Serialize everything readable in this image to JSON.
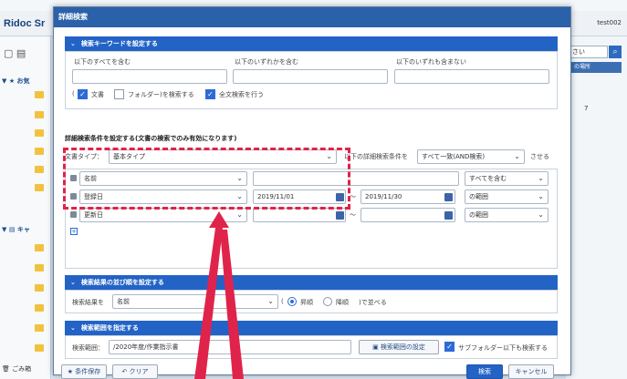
{
  "background": {
    "logo": "Ridoc Sr",
    "user": "test002",
    "favorites": "お気",
    "cabinet": "キャ",
    "trash": "ごみ箱",
    "search_placeholder": "さい",
    "place_label": "の場所",
    "side_number": "7"
  },
  "modal": {
    "title": "詳細検索",
    "keyword_section": {
      "header": "検索キーワードを設定する",
      "all_label": "以下のすべてを含む",
      "any_label": "以下のいずれかを含む",
      "none_label": "以下のいずれも含まない",
      "all_value": "",
      "any_value": "",
      "none_value": "",
      "paren_open": "(",
      "doc_label": "文書",
      "folder_label": "フォルダー)を検索する",
      "fulltext_label": "全文検索を行う"
    },
    "condition_section": {
      "title": "詳細検索条件を設定する(文書の検索でのみ有効になります)",
      "doctype_label": "文書タイプ：",
      "doctype_value": "基本タイプ",
      "cond_mode_label": "以下の詳細検索条件を",
      "cond_mode_value": "すべて一致(AND検索)",
      "cond_mode_suffix": "させる",
      "rows": [
        {
          "field": "名前",
          "value1": "",
          "value2": "",
          "op": "すべてを含む"
        },
        {
          "field": "登録日",
          "value1": "2019/11/01",
          "tilde": "～",
          "value2": "2019/11/30",
          "op": "の範囲"
        },
        {
          "field": "更新日",
          "value1": "",
          "tilde": "～",
          "value2": "",
          "op": "の範囲"
        }
      ]
    },
    "sort_section": {
      "header": "検索結果の並び順を設定する",
      "label": "検索結果を",
      "field": "名前",
      "asc": "昇順",
      "desc": "降順",
      "suffix": ")で並べる",
      "paren": "("
    },
    "scope_section": {
      "header": "検索範囲を指定する",
      "label": "検索範囲：",
      "value": "/2020年度/作業指示書",
      "set_button": "検索範囲の設定",
      "subfolder_label": "サブフォルダー以下も検索する"
    },
    "footer": {
      "save": "条件保存",
      "clear": "クリア",
      "search": "検索",
      "cancel": "キャンセル"
    }
  }
}
